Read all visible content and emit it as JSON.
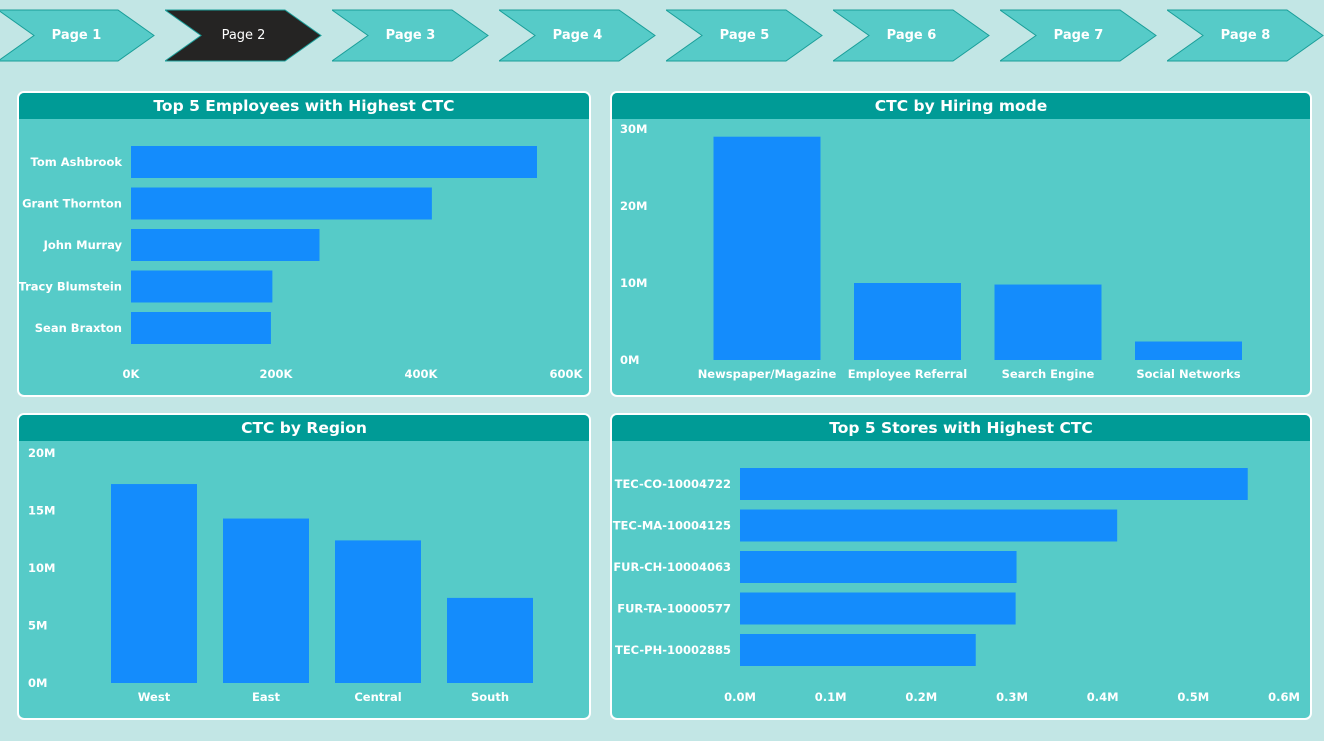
{
  "nav": {
    "tabs": [
      {
        "label": "Page 1",
        "active": false
      },
      {
        "label": "Page 2",
        "active": true
      },
      {
        "label": "Page 3",
        "active": false
      },
      {
        "label": "Page 4",
        "active": false
      },
      {
        "label": "Page 5",
        "active": false
      },
      {
        "label": "Page 6",
        "active": false
      },
      {
        "label": "Page 7",
        "active": false
      },
      {
        "label": "Page 8",
        "active": false
      }
    ]
  },
  "colors": {
    "background": "#c2e6e5",
    "card": "#56cbc8",
    "card_header": "#009b96",
    "bar": "#148cfc",
    "tab": "#56cbc8",
    "tab_active": "#252423",
    "text": "#ffffff"
  },
  "chart_data": [
    {
      "id": "employees",
      "type": "bar",
      "orientation": "horizontal",
      "title": "Top 5 Employees with Highest CTC",
      "categories": [
        "Tom Ashbrook",
        "Grant Thornton",
        "John Murray",
        "Tracy Blumstein",
        "Sean Braxton"
      ],
      "values": [
        560000,
        415000,
        260000,
        195000,
        193000
      ],
      "xlim": [
        0,
        600000
      ],
      "ticks": [
        {
          "value": 0,
          "label": "0K"
        },
        {
          "value": 200000,
          "label": "200K"
        },
        {
          "value": 400000,
          "label": "400K"
        },
        {
          "value": 600000,
          "label": "600K"
        }
      ],
      "grid": false
    },
    {
      "id": "hiring",
      "type": "bar",
      "orientation": "vertical",
      "title": "CTC by Hiring mode",
      "categories": [
        "Newspaper/Magazine",
        "Employee Referral",
        "Search Engine",
        "Social Networks"
      ],
      "values": [
        29000000,
        10000000,
        9800000,
        2400000
      ],
      "ylim": [
        0,
        30000000
      ],
      "ticks": [
        {
          "value": 0,
          "label": "0M"
        },
        {
          "value": 10000000,
          "label": "10M"
        },
        {
          "value": 20000000,
          "label": "20M"
        },
        {
          "value": 30000000,
          "label": "30M"
        }
      ],
      "grid": false
    },
    {
      "id": "region",
      "type": "bar",
      "orientation": "vertical",
      "title": "CTC by Region",
      "categories": [
        "West",
        "East",
        "Central",
        "South"
      ],
      "values": [
        17300000,
        14300000,
        12400000,
        7400000
      ],
      "ylim": [
        0,
        20000000
      ],
      "ticks": [
        {
          "value": 0,
          "label": "0M"
        },
        {
          "value": 5000000,
          "label": "5M"
        },
        {
          "value": 10000000,
          "label": "10M"
        },
        {
          "value": 15000000,
          "label": "15M"
        },
        {
          "value": 20000000,
          "label": "20M"
        }
      ],
      "grid": false
    },
    {
      "id": "stores",
      "type": "bar",
      "orientation": "horizontal",
      "title": "Top 5 Stores with Highest CTC",
      "categories": [
        "TEC-CO-10004722",
        "TEC-MA-10004125",
        "FUR-CH-10004063",
        "FUR-TA-10000577",
        "TEC-PH-10002885"
      ],
      "values": [
        560000,
        416000,
        305000,
        304000,
        260000
      ],
      "xlim": [
        0,
        600000
      ],
      "ticks": [
        {
          "value": 0,
          "label": "0.0M"
        },
        {
          "value": 100000,
          "label": "0.1M"
        },
        {
          "value": 200000,
          "label": "0.2M"
        },
        {
          "value": 300000,
          "label": "0.3M"
        },
        {
          "value": 400000,
          "label": "0.4M"
        },
        {
          "value": 500000,
          "label": "0.5M"
        },
        {
          "value": 600000,
          "label": "0.6M"
        }
      ],
      "grid": false
    }
  ]
}
